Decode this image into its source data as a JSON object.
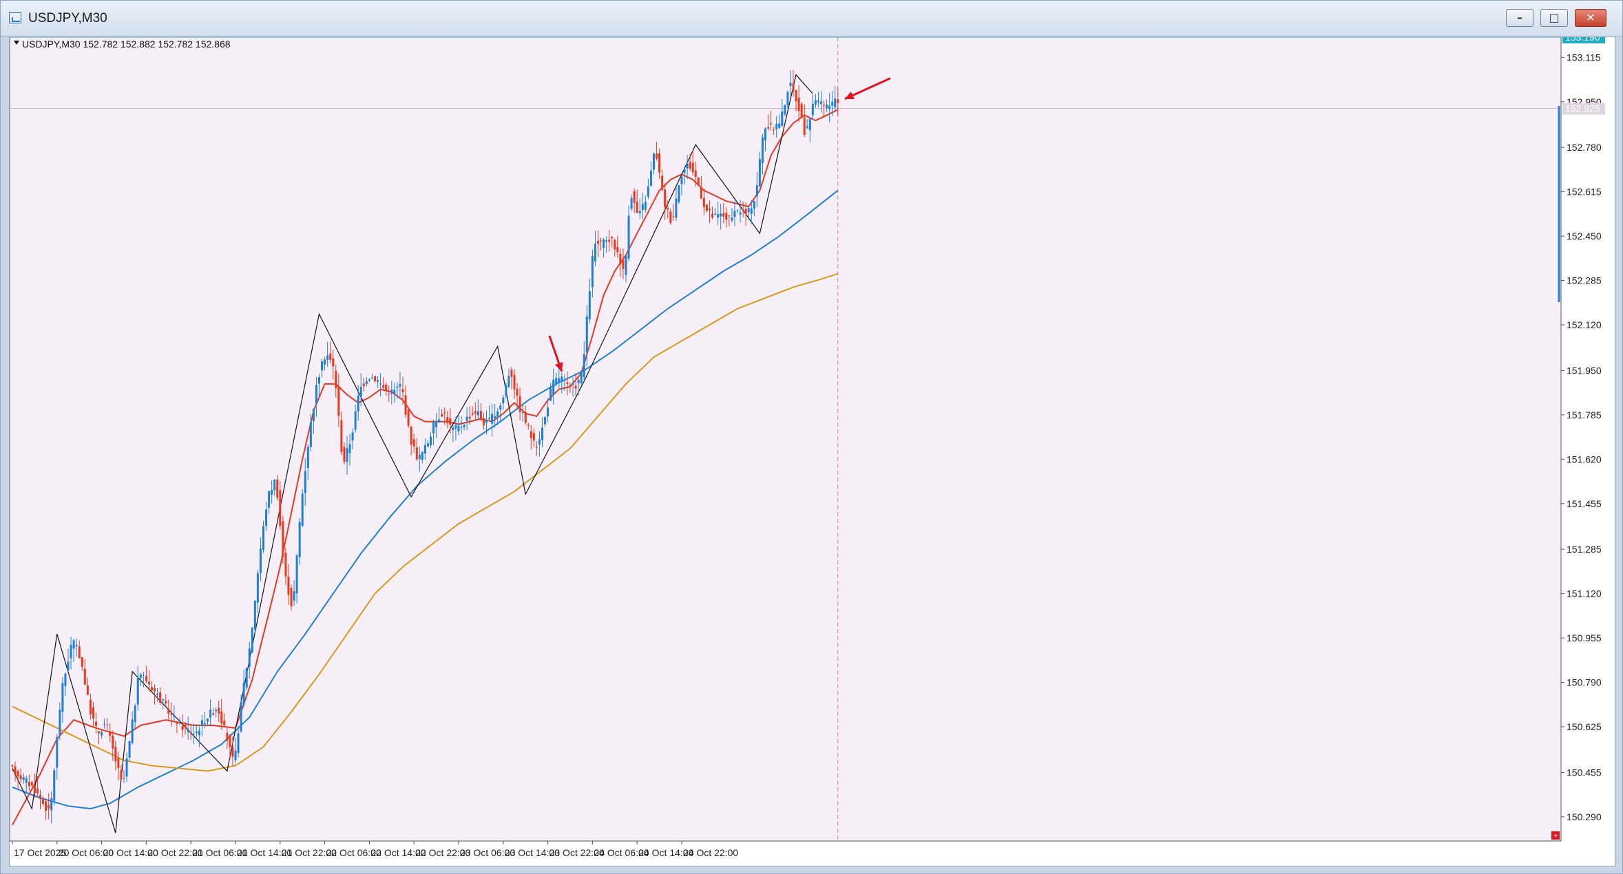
{
  "window": {
    "title": "USDJPY,M30",
    "buttons": {
      "minimize": "–",
      "restore": "□",
      "close": "✕"
    }
  },
  "chart": {
    "info_label": "USDJPY,M30  152.782 152.882 152.782 152.868",
    "current_bid": "152.925",
    "top_marker": "153.190",
    "corner_marker": "+"
  },
  "chart_data": {
    "type": "line",
    "symbol": "USDJPY",
    "timeframe": "M30",
    "ylim": [
      150.2,
      153.19
    ],
    "y_ticks": [
      "153.115",
      "152.950",
      "152.780",
      "152.615",
      "152.450",
      "152.285",
      "152.120",
      "151.950",
      "151.785",
      "151.620",
      "151.455",
      "151.285",
      "151.120",
      "150.955",
      "150.790",
      "150.625",
      "150.455",
      "150.290"
    ],
    "x_ticks": [
      "17 Oct 2025",
      "20 Oct 06:00",
      "20 Oct 14:00",
      "20 Oct 22:00",
      "21 Oct 06:00",
      "21 Oct 14:00",
      "21 Oct 22:00",
      "22 Oct 06:00",
      "22 Oct 14:00",
      "22 Oct 22:00",
      "23 Oct 06:00",
      "23 Oct 14:00",
      "23 Oct 22:00",
      "24 Oct 06:00",
      "24 Oct 14:00",
      "24 Oct 22:00"
    ],
    "price_path": [
      [
        0,
        150.47
      ],
      [
        8,
        150.4
      ],
      [
        14,
        150.3
      ],
      [
        18,
        150.75
      ],
      [
        22,
        150.95
      ],
      [
        25,
        150.88
      ],
      [
        28,
        150.7
      ],
      [
        31,
        150.6
      ],
      [
        34,
        150.64
      ],
      [
        37,
        150.52
      ],
      [
        40,
        150.4
      ],
      [
        43,
        150.6
      ],
      [
        46,
        150.83
      ],
      [
        50,
        150.78
      ],
      [
        54,
        150.72
      ],
      [
        58,
        150.66
      ],
      [
        62,
        150.62
      ],
      [
        66,
        150.6
      ],
      [
        70,
        150.66
      ],
      [
        74,
        150.7
      ],
      [
        77,
        150.6
      ],
      [
        80,
        150.48
      ],
      [
        83,
        150.75
      ],
      [
        86,
        150.95
      ],
      [
        89,
        151.25
      ],
      [
        92,
        151.48
      ],
      [
        95,
        151.55
      ],
      [
        98,
        151.2
      ],
      [
        101,
        151.06
      ],
      [
        104,
        151.45
      ],
      [
        107,
        151.72
      ],
      [
        110,
        151.92
      ],
      [
        113,
        152.02
      ],
      [
        116,
        151.95
      ],
      [
        119,
        151.6
      ],
      [
        122,
        151.7
      ],
      [
        125,
        151.88
      ],
      [
        128,
        151.93
      ],
      [
        131,
        151.92
      ],
      [
        134,
        151.88
      ],
      [
        137,
        151.87
      ],
      [
        140,
        151.9
      ],
      [
        143,
        151.7
      ],
      [
        146,
        151.62
      ],
      [
        149,
        151.67
      ],
      [
        152,
        151.76
      ],
      [
        155,
        151.8
      ],
      [
        158,
        151.73
      ],
      [
        161,
        151.74
      ],
      [
        164,
        151.78
      ],
      [
        167,
        151.8
      ],
      [
        170,
        151.75
      ],
      [
        173,
        151.78
      ],
      [
        176,
        151.83
      ],
      [
        179,
        151.96
      ],
      [
        182,
        151.82
      ],
      [
        185,
        151.75
      ],
      [
        188,
        151.66
      ],
      [
        191,
        151.75
      ],
      [
        194,
        151.9
      ],
      [
        197,
        151.93
      ],
      [
        200,
        151.88
      ],
      [
        203,
        151.9
      ],
      [
        205,
        151.95
      ],
      [
        207,
        152.2
      ],
      [
        209,
        152.42
      ],
      [
        212,
        152.42
      ],
      [
        215,
        152.44
      ],
      [
        218,
        152.38
      ],
      [
        220,
        152.3
      ],
      [
        222,
        152.62
      ],
      [
        225,
        152.52
      ],
      [
        228,
        152.6
      ],
      [
        231,
        152.78
      ],
      [
        234,
        152.58
      ],
      [
        237,
        152.5
      ],
      [
        240,
        152.68
      ],
      [
        243,
        152.72
      ],
      [
        246,
        152.66
      ],
      [
        249,
        152.55
      ],
      [
        252,
        152.52
      ],
      [
        255,
        152.53
      ],
      [
        258,
        152.51
      ],
      [
        261,
        152.55
      ],
      [
        264,
        152.53
      ],
      [
        267,
        152.6
      ],
      [
        270,
        152.86
      ],
      [
        273,
        152.85
      ],
      [
        276,
        152.88
      ],
      [
        279,
        153.02
      ],
      [
        282,
        152.95
      ],
      [
        285,
        152.82
      ],
      [
        288,
        152.97
      ],
      [
        291,
        152.93
      ],
      [
        294,
        152.94
      ],
      [
        296,
        152.95
      ]
    ],
    "series": [
      {
        "name": "MA short",
        "color": "#e8391e",
        "values": [
          [
            0,
            150.26
          ],
          [
            10,
            150.45
          ],
          [
            16,
            150.58
          ],
          [
            22,
            150.65
          ],
          [
            30,
            150.62
          ],
          [
            40,
            150.59
          ],
          [
            46,
            150.63
          ],
          [
            55,
            150.65
          ],
          [
            65,
            150.63
          ],
          [
            72,
            150.63
          ],
          [
            80,
            150.62
          ],
          [
            86,
            150.8
          ],
          [
            92,
            151.05
          ],
          [
            96,
            151.22
          ],
          [
            100,
            151.42
          ],
          [
            104,
            151.62
          ],
          [
            108,
            151.8
          ],
          [
            112,
            151.9
          ],
          [
            116,
            151.9
          ],
          [
            120,
            151.86
          ],
          [
            124,
            151.83
          ],
          [
            128,
            151.85
          ],
          [
            132,
            151.88
          ],
          [
            136,
            151.87
          ],
          [
            140,
            151.84
          ],
          [
            144,
            151.78
          ],
          [
            148,
            151.76
          ],
          [
            152,
            151.76
          ],
          [
            156,
            151.76
          ],
          [
            160,
            151.75
          ],
          [
            164,
            151.76
          ],
          [
            168,
            151.77
          ],
          [
            172,
            151.76
          ],
          [
            176,
            151.79
          ],
          [
            180,
            151.83
          ],
          [
            184,
            151.79
          ],
          [
            188,
            151.78
          ],
          [
            192,
            151.84
          ],
          [
            196,
            151.88
          ],
          [
            200,
            151.89
          ],
          [
            204,
            151.94
          ],
          [
            208,
            152.08
          ],
          [
            212,
            152.23
          ],
          [
            216,
            152.32
          ],
          [
            220,
            152.38
          ],
          [
            224,
            152.46
          ],
          [
            228,
            152.54
          ],
          [
            232,
            152.62
          ],
          [
            236,
            152.66
          ],
          [
            240,
            152.68
          ],
          [
            244,
            152.66
          ],
          [
            248,
            152.62
          ],
          [
            252,
            152.6
          ],
          [
            256,
            152.58
          ],
          [
            260,
            152.57
          ],
          [
            264,
            152.56
          ],
          [
            268,
            152.62
          ],
          [
            272,
            152.75
          ],
          [
            276,
            152.82
          ],
          [
            280,
            152.87
          ],
          [
            284,
            152.9
          ],
          [
            288,
            152.88
          ],
          [
            292,
            152.9
          ],
          [
            296,
            152.92
          ]
        ]
      },
      {
        "name": "MA medium",
        "color": "#1e7fd8",
        "values": [
          [
            0,
            150.4
          ],
          [
            10,
            150.36
          ],
          [
            20,
            150.33
          ],
          [
            28,
            150.32
          ],
          [
            35,
            150.34
          ],
          [
            45,
            150.4
          ],
          [
            55,
            150.45
          ],
          [
            65,
            150.5
          ],
          [
            75,
            150.56
          ],
          [
            85,
            150.66
          ],
          [
            95,
            150.83
          ],
          [
            105,
            150.97
          ],
          [
            115,
            151.12
          ],
          [
            125,
            151.27
          ],
          [
            135,
            151.4
          ],
          [
            145,
            151.52
          ],
          [
            155,
            151.61
          ],
          [
            165,
            151.69
          ],
          [
            175,
            151.76
          ],
          [
            185,
            151.84
          ],
          [
            195,
            151.9
          ],
          [
            205,
            151.95
          ],
          [
            215,
            152.02
          ],
          [
            225,
            152.1
          ],
          [
            235,
            152.18
          ],
          [
            245,
            152.25
          ],
          [
            255,
            152.32
          ],
          [
            265,
            152.38
          ],
          [
            275,
            152.45
          ],
          [
            285,
            152.53
          ],
          [
            296,
            152.62
          ]
        ]
      },
      {
        "name": "MA long",
        "color": "#d99a1a",
        "values": [
          [
            0,
            150.7
          ],
          [
            10,
            150.65
          ],
          [
            20,
            150.6
          ],
          [
            30,
            150.55
          ],
          [
            40,
            150.5
          ],
          [
            50,
            150.48
          ],
          [
            60,
            150.47
          ],
          [
            70,
            150.46
          ],
          [
            80,
            150.48
          ],
          [
            90,
            150.55
          ],
          [
            100,
            150.68
          ],
          [
            110,
            150.82
          ],
          [
            120,
            150.97
          ],
          [
            130,
            151.12
          ],
          [
            140,
            151.22
          ],
          [
            150,
            151.3
          ],
          [
            160,
            151.38
          ],
          [
            170,
            151.44
          ],
          [
            180,
            151.5
          ],
          [
            190,
            151.58
          ],
          [
            200,
            151.66
          ],
          [
            210,
            151.78
          ],
          [
            220,
            151.9
          ],
          [
            230,
            152.0
          ],
          [
            240,
            152.06
          ],
          [
            250,
            152.12
          ],
          [
            260,
            152.18
          ],
          [
            270,
            152.22
          ],
          [
            280,
            152.26
          ],
          [
            290,
            152.29
          ],
          [
            296,
            152.31
          ]
        ]
      }
    ],
    "zigzag": [
      [
        0,
        150.47
      ],
      [
        7,
        150.32
      ],
      [
        16,
        150.97
      ],
      [
        37,
        150.23
      ],
      [
        43,
        150.83
      ],
      [
        77,
        150.46
      ],
      [
        110,
        152.16
      ],
      [
        143,
        151.48
      ],
      [
        174,
        152.04
      ],
      [
        184,
        151.49
      ],
      [
        205,
        151.91
      ],
      [
        245,
        152.79
      ],
      [
        268,
        152.46
      ],
      [
        281,
        153.05
      ],
      [
        287,
        152.98
      ]
    ],
    "current_bar_index": 296,
    "annotations": [
      {
        "kind": "arrow",
        "color": "#e0141e",
        "points_to": [
          197,
          151.9
        ]
      },
      {
        "kind": "arrow",
        "color": "#e0141e",
        "points_to": [
          298,
          152.95
        ]
      }
    ],
    "colors": {
      "bull": "#1e7fd8",
      "bear": "#e8391e",
      "background": "#f6eff8",
      "grid_hline": "#c8b8c8"
    }
  }
}
